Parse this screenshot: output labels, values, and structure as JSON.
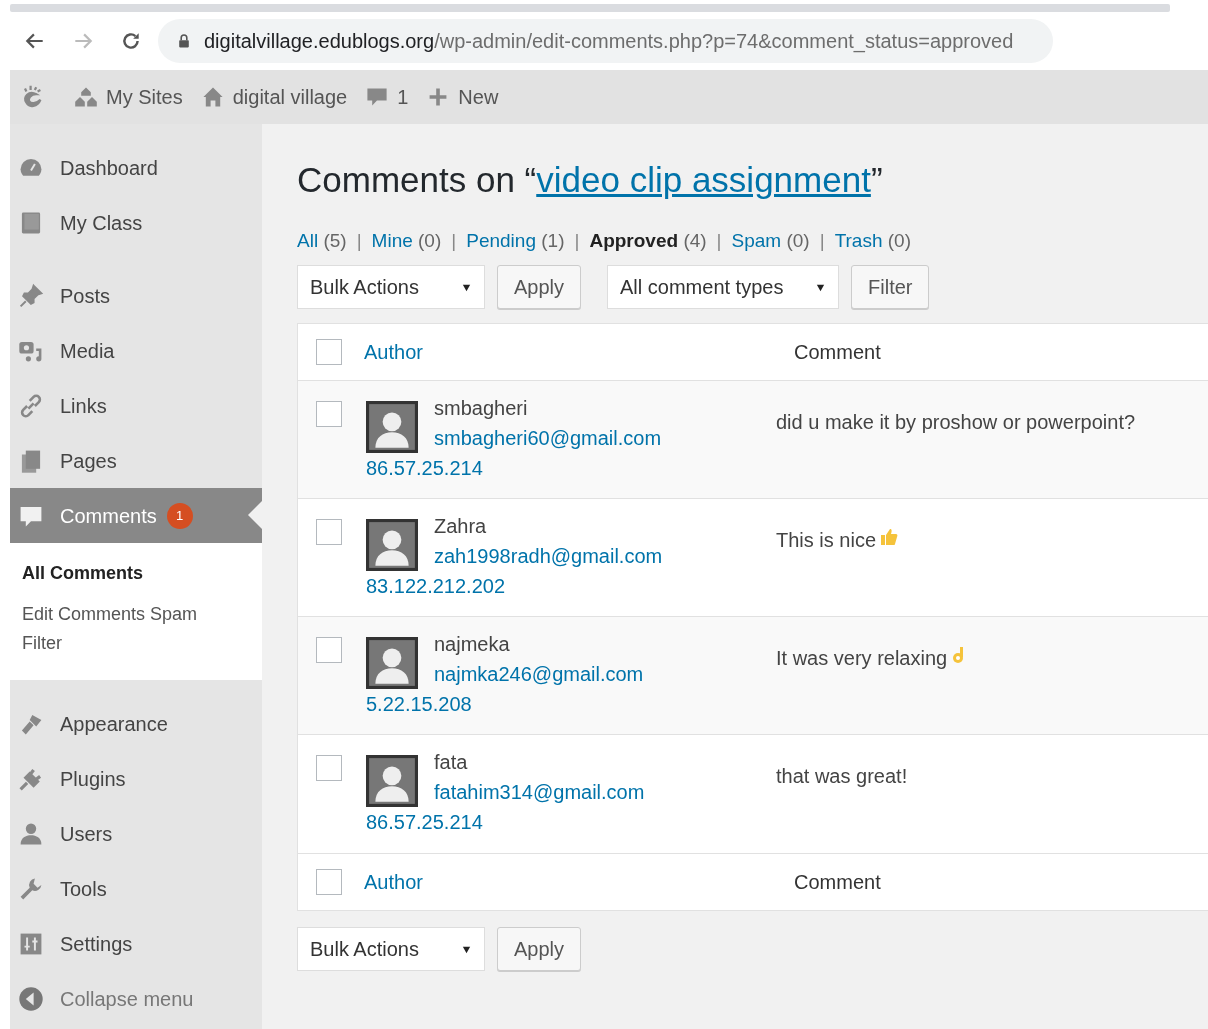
{
  "browser": {
    "url_host": "digitalvillage.edublogs.org",
    "url_path": "/wp-admin/edit-comments.php?p=74&comment_status=approved"
  },
  "admin_bar": {
    "items": [
      {
        "kind": "logo"
      },
      {
        "kind": "sites",
        "label": "My Sites"
      },
      {
        "kind": "home",
        "label": "digital village"
      },
      {
        "kind": "comments",
        "label": "1"
      },
      {
        "kind": "new",
        "label": "New"
      }
    ]
  },
  "sidebar": {
    "items": [
      {
        "label": "Dashboard",
        "selected": false
      },
      {
        "label": "My Class",
        "selected": false
      },
      {
        "label": "Posts",
        "selected": false
      },
      {
        "label": "Media",
        "selected": false
      },
      {
        "label": "Links",
        "selected": false
      },
      {
        "label": "Pages",
        "selected": false
      },
      {
        "label": "Comments",
        "selected": true,
        "badge": "1",
        "children": [
          {
            "label": "All Comments",
            "selected": true
          },
          {
            "label": "Edit Comments Spam Filter",
            "selected": false
          }
        ]
      },
      {
        "label": "Appearance",
        "selected": false
      },
      {
        "label": "Plugins",
        "selected": false
      },
      {
        "label": "Users",
        "selected": false
      },
      {
        "label": "Tools",
        "selected": false
      },
      {
        "label": "Settings",
        "selected": false
      },
      {
        "label": "Collapse menu",
        "selected": false,
        "kind": "collapse"
      }
    ]
  },
  "heading": {
    "prefix": "Comments on “",
    "link": "video clip assignment",
    "suffix": "”"
  },
  "filters": [
    {
      "label": "All",
      "count": "(5)",
      "selected": false
    },
    {
      "separator": "|",
      "label": "Mine",
      "count": "(0)",
      "selected": false
    },
    {
      "separator": "|",
      "label": "Pending",
      "count": "(1)",
      "selected": false
    },
    {
      "separator": "|",
      "label": "Approved",
      "count": "(4)",
      "selected": true
    },
    {
      "separator": "|",
      "label": "Spam",
      "count": "(0)",
      "selected": false
    },
    {
      "separator": "|",
      "label": "Trash",
      "count": "(0)",
      "selected": false
    }
  ],
  "toolbar": {
    "bulk": "Bulk Actions",
    "apply": "Apply",
    "types": "All comment types",
    "filter": "Filter"
  },
  "table": {
    "columns": [
      "Author",
      "Comment"
    ],
    "header_checked": false,
    "footer_checked": false,
    "rows": [
      {
        "name": "smbagheri",
        "email": "smbagheri60@gmail.com",
        "ip": "86.57.25.214",
        "comment": "did u make it by proshow or powerpoint?",
        "checked": false
      },
      {
        "name": "Zahra",
        "email": "zah1998radh@gmail.com",
        "ip": "83.122.212.202",
        "comment": "This is nice",
        "checked": false
      },
      {
        "name": "najmeka",
        "email": "najmka246@gmail.com",
        "ip": "5.22.15.208",
        "comment": "It was very relaxing",
        "checked": false
      },
      {
        "name": "fata",
        "email": "fatahim314@gmail.com",
        "ip": "86.57.25.214",
        "comment": "that was great!",
        "checked": false
      }
    ],
    "footer_columns": [
      "Author",
      "Comment"
    ]
  },
  "bottom_toolbar": {
    "bulk": "Bulk Actions",
    "apply": "Apply"
  }
}
